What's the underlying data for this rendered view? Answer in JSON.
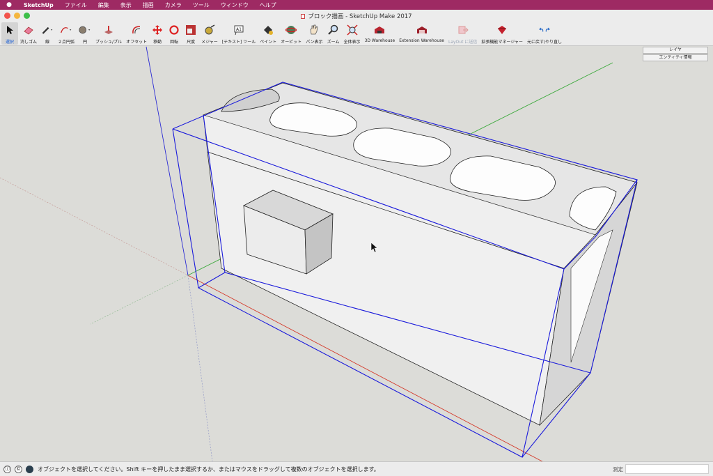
{
  "menubar": {
    "app": "SketchUp",
    "items": [
      "ファイル",
      "編集",
      "表示",
      "描画",
      "カメラ",
      "ツール",
      "ウィンドウ",
      "ヘルプ"
    ]
  },
  "window": {
    "title": "ブロック描画 - SketchUp Make 2017"
  },
  "toolbar": {
    "tools": [
      {
        "label": "選択",
        "icon": "select-arrow-icon",
        "active": true
      },
      {
        "label": "消しゴム",
        "icon": "eraser-icon"
      },
      {
        "label": "線",
        "icon": "pencil-icon"
      },
      {
        "label": "２点円弧",
        "icon": "arc-icon"
      },
      {
        "label": "円",
        "icon": "circle-icon"
      },
      {
        "label": "プッシュ/プル",
        "icon": "push-pull-icon"
      },
      {
        "label": "オフセット",
        "icon": "offset-icon"
      },
      {
        "label": "移動",
        "icon": "move-icon"
      },
      {
        "label": "回転",
        "icon": "rotate-icon"
      },
      {
        "label": "尺度",
        "icon": "scale-icon"
      },
      {
        "label": "メジャー",
        "icon": "tape-measure-icon"
      },
      {
        "label": "[テキスト] ツール",
        "icon": "text-icon"
      },
      {
        "label": "ペイント",
        "icon": "paint-bucket-icon"
      },
      {
        "label": "オービット",
        "icon": "orbit-icon"
      },
      {
        "label": "パン表示",
        "icon": "pan-hand-icon"
      },
      {
        "label": "ズーム",
        "icon": "zoom-icon"
      },
      {
        "label": "全体表示",
        "icon": "zoom-extents-icon"
      },
      {
        "label": "3D Warehouse",
        "icon": "warehouse-icon"
      },
      {
        "label": "Extension Warehouse",
        "icon": "extension-warehouse-icon"
      },
      {
        "label": "LayOut に送信",
        "icon": "layout-send-icon",
        "disabled": true
      },
      {
        "label": "拡張機能マネージャー",
        "icon": "extension-manager-icon"
      },
      {
        "label": "元に戻す/やり直し",
        "icon": "undo-redo-icon"
      }
    ]
  },
  "tray": {
    "layers_label": "レイヤ",
    "entity_info_label": "エンティティ情報"
  },
  "statusbar": {
    "message": "オブジェクトを選択してください。Shift キーを押したまま選択するか、またはマウスをドラッグして複数のオブジェクトを選択します。",
    "measure_label": "測定",
    "measure_value": ""
  },
  "colors": {
    "menubar_bg": "#9e2a63",
    "selection": "#1a1adb",
    "axis_red": "#d43a2a",
    "axis_green": "#3aa83a",
    "axis_blue": "#2a2ad4"
  }
}
